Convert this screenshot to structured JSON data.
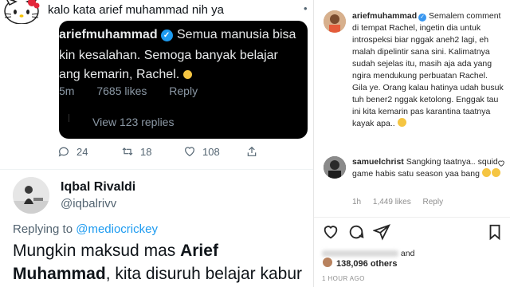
{
  "twitter": {
    "top_text": "kalo kata arief muhammad nih ya",
    "embedded_reply": {
      "username": "ariefmuhammad",
      "line1": "Semua manusia bisa",
      "line2": "kin kesalahan. Semoga banyak belajar",
      "line3": "ang kemarin, Rachel.",
      "time": "5m",
      "likes": "7685 likes",
      "reply_label": "Reply",
      "view_replies": "View 123 replies"
    },
    "actions": {
      "replies": "24",
      "retweets": "18",
      "likes": "108"
    },
    "reply_tweet": {
      "name": "Iqbal Rivaldi",
      "handle": "@iqbalrivv",
      "replying_prefix": "Replying to",
      "replying_to": "@mediocrickey",
      "text_a": "Mungkin maksud mas ",
      "text_b": "Arief",
      "text_c": "Muhammad",
      "text_d": ", kita disuruh belajar kabur"
    }
  },
  "instagram": {
    "caption_user": "ariefmuhammad",
    "caption_text": "Semalem comment di tempat Rachel, ingetin dia untuk introspeksi biar nggak aneh2 lagi, eh malah dipelintir sana sini. Kalimatnya sudah sejelas itu, masih aja ada yang ngira mendukung perbuatan Rachel. Gila ye. Orang kalau hatinya udah busuk tuh bener2 nggak ketolong. Enggak tau ini kita kemarin pas karantina taatnya kayak apa..",
    "comment_user": "samuelchrist",
    "comment_text": "Sangking taatnya.. squid game habis satu season yaa bang",
    "comment_time": "1h",
    "comment_likes": "1,449 likes",
    "comment_reply": "Reply",
    "liked_suffix": "and",
    "likes_count": "138,096 others",
    "post_time": "1 HOUR AGO"
  }
}
